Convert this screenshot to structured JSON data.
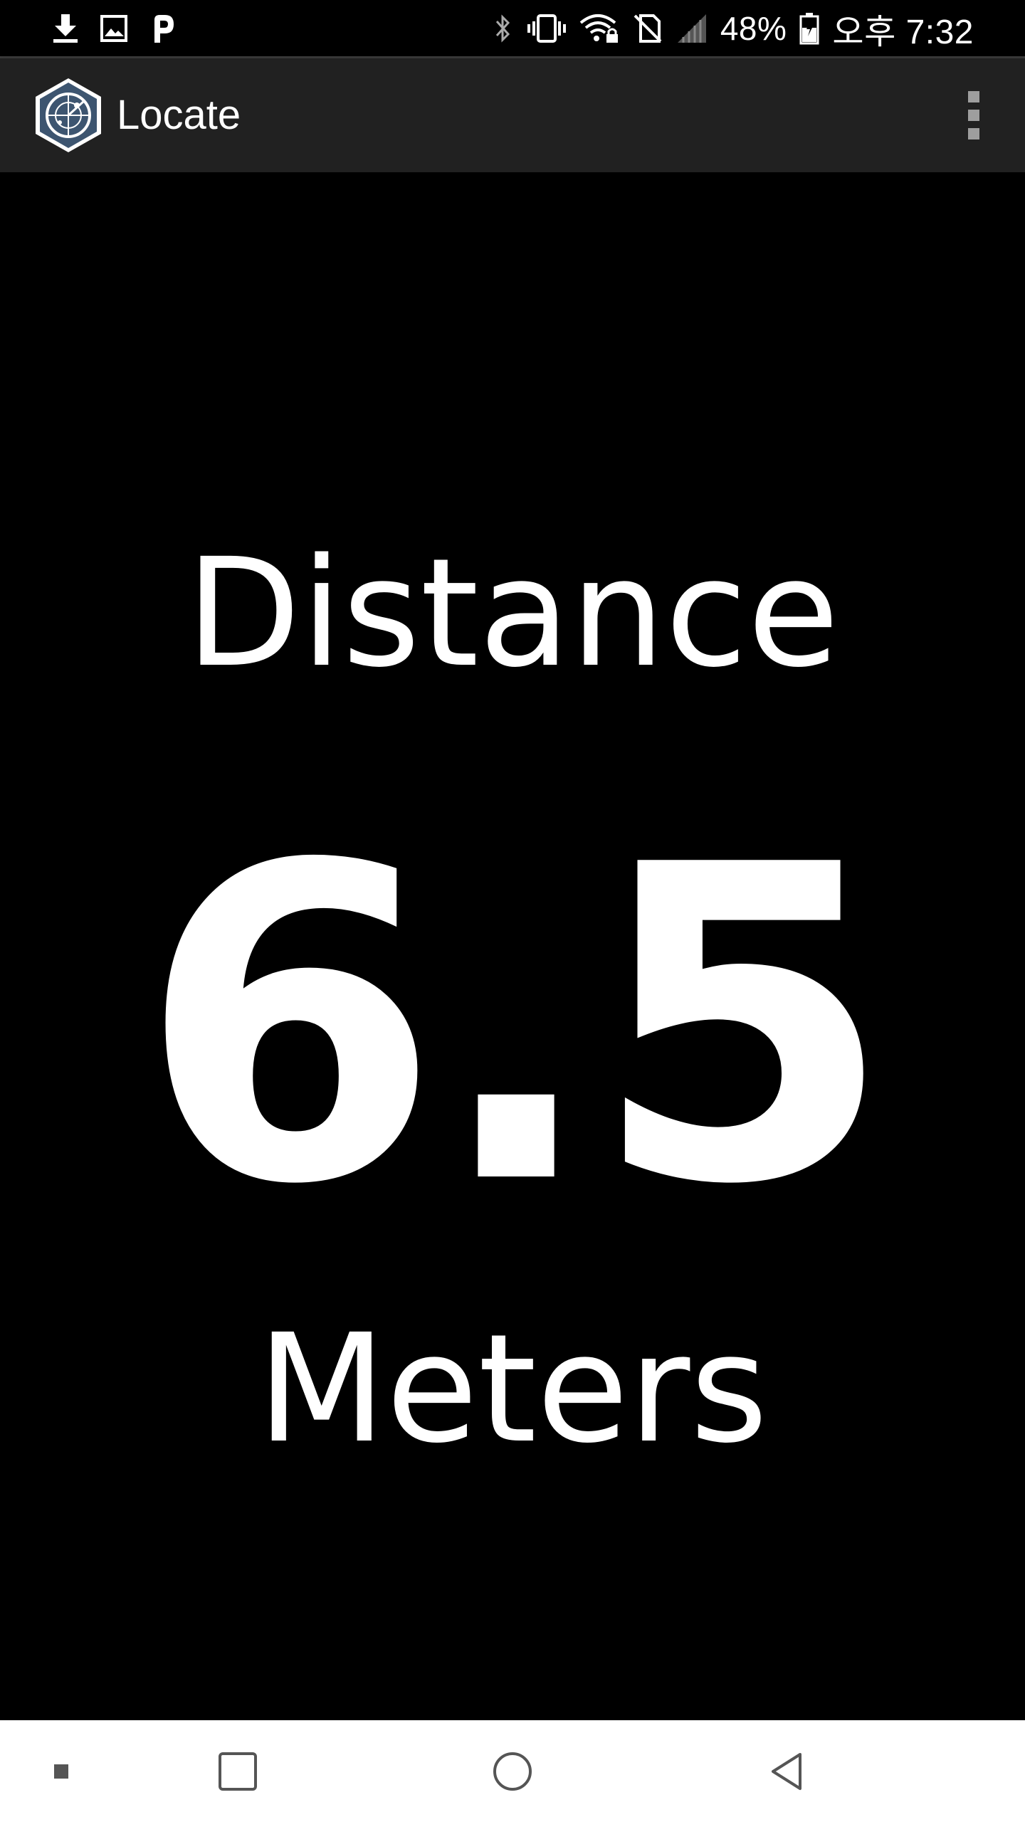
{
  "status_bar": {
    "icons_left": [
      "download-icon",
      "image-icon",
      "p-notification-icon"
    ],
    "icons_right": [
      "bluetooth-icon",
      "vibrate-icon",
      "wifi-lock-icon",
      "no-sim-icon",
      "signal-icon"
    ],
    "battery_percent": "48%",
    "time": "오후 7:32"
  },
  "app_bar": {
    "title": "Locate",
    "logo_icon": "radar-hexagon-icon",
    "menu_icon": "overflow-menu-icon",
    "background": "#212121"
  },
  "main": {
    "heading": "Distance",
    "value": "6.5",
    "unit": "Meters"
  },
  "nav_bar": {
    "items": [
      "recent-dot-icon",
      "recents-square-icon",
      "home-circle-icon",
      "back-triangle-icon"
    ]
  },
  "colors": {
    "background": "#000000",
    "text": "#ffffff",
    "logo_fill": "#3d5570"
  }
}
